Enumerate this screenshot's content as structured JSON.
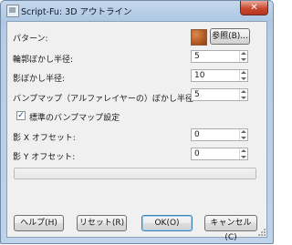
{
  "window": {
    "title": "Script-Fu: 3D アウトライン",
    "close_glyph": "✕"
  },
  "form": {
    "pattern_label": "パターン:",
    "browse_button": "参照(B)...",
    "outline_blur_label": "輪郭ぼかし半径:",
    "outline_blur_value": "5",
    "shadow_blur_label": "影ぼかし半径:",
    "shadow_blur_value": "10",
    "bumpmap_blur_label": "バンプマップ（アルファレイヤーの）ぼかし半径:",
    "bumpmap_blur_value": "5",
    "default_bumpmap_label": "標準のバンプマップ設定",
    "default_bumpmap_checked": true,
    "check_glyph": "✓",
    "shadow_x_label": "影 X オフセット:",
    "shadow_x_value": "0",
    "shadow_y_label": "影 Y オフセット:",
    "shadow_y_value": "0"
  },
  "progress": {
    "value": 0
  },
  "buttons": {
    "help": "ヘルプ(H)",
    "reset": "リセット(R)",
    "ok": "OK(O)",
    "cancel": "キャンセル(C)"
  },
  "icons": {
    "app": "script-fu-icon",
    "close": "close-icon",
    "pattern": "pattern-swatch-icon"
  }
}
